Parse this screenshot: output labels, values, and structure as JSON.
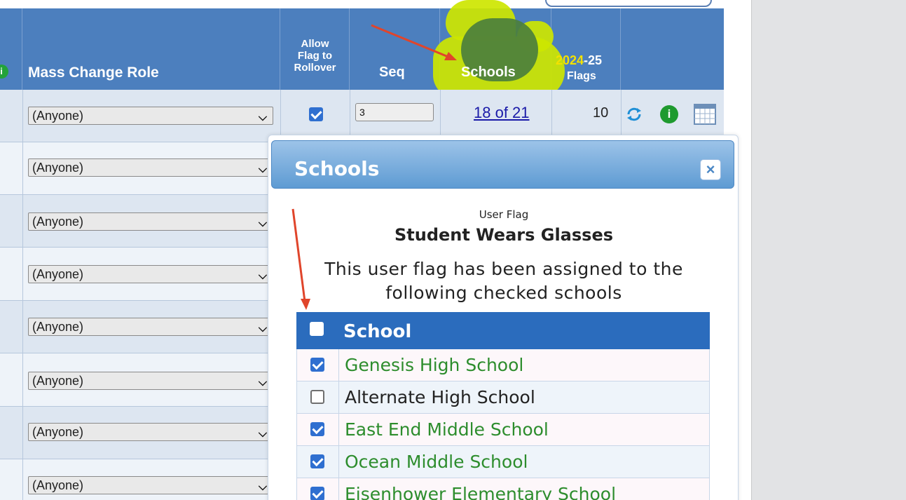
{
  "header": {
    "mass_change_role": "Mass Change Role",
    "allow_flag_rollover": [
      "Allow",
      "Flag to",
      "Rollover"
    ],
    "seq": "Seq",
    "schools": "Schools",
    "flags_year_a": "2024",
    "flags_year_b": "-25",
    "flags_word": "Flags"
  },
  "rows": [
    {
      "role": "(Anyone)",
      "rollover": true,
      "seq": "3",
      "schools": "18 of 21",
      "flags": "10"
    },
    {
      "role": "(Anyone)"
    },
    {
      "role": "(Anyone)"
    },
    {
      "role": "(Anyone)"
    },
    {
      "role": "(Anyone)"
    },
    {
      "role": "(Anyone)"
    },
    {
      "role": "(Anyone)"
    },
    {
      "role": "(Anyone)"
    }
  ],
  "modal": {
    "title": "Schools",
    "close_glyph": "×",
    "caption_small": "User Flag",
    "flag_name": "Student Wears Glasses",
    "description_line1": "This user flag has been assigned to the",
    "description_line2": "following checked schools",
    "table_header": "School",
    "schools": [
      {
        "name": "Genesis High School",
        "checked": true
      },
      {
        "name": "Alternate High School",
        "checked": false
      },
      {
        "name": "East End Middle School",
        "checked": true
      },
      {
        "name": "Ocean Middle School",
        "checked": true
      },
      {
        "name": "Eisenhower Elementary School",
        "checked": true
      }
    ]
  },
  "colors": {
    "header_bg": "#4c7fbe",
    "highlight": "#cde600",
    "flags_year": "#f3e100",
    "link": "#1a1aa8",
    "checked_school": "#2d8d2d",
    "arrow": "#e0452b"
  }
}
